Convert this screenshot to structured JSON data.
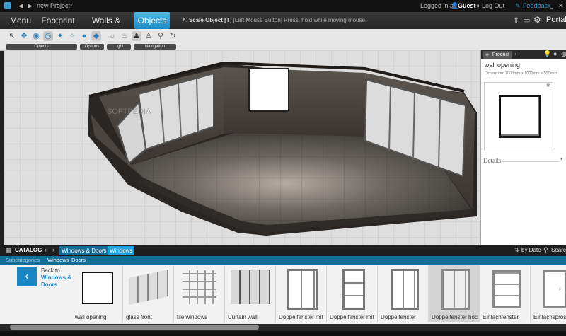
{
  "titlebar": {
    "project": "new Project*"
  },
  "menu": {
    "tabs": [
      {
        "label": "Menu"
      },
      {
        "label": "Footprint"
      },
      {
        "label": "Walls & Floors"
      },
      {
        "label": "Objects"
      }
    ],
    "hint_bold": "Scale Object [T]",
    "hint_text": "[Left Mouse Button] Press, hold while moving mouse.",
    "logged_in": "Logged in as",
    "user": "Guest",
    "logout": "Log Out",
    "feedback": "Feedback",
    "portal": "Portal"
  },
  "toolbar": {
    "groups": [
      "Objects",
      "Options",
      "Light",
      "Navigation"
    ]
  },
  "panel": {
    "tab": "Product",
    "name": "wall opening",
    "dimension": "Dimension: 1000mm x 1000mm x 500mm",
    "details": "Details"
  },
  "catalog": {
    "title": "CATALOG",
    "crumb1": "Windows & Doors",
    "crumb2": "Windows",
    "sort": "by Date",
    "search": "Search",
    "subcat_label": "Subcategories",
    "subcats": [
      "Windows",
      "Doors"
    ],
    "back_line1": "Back to",
    "back_line2": "Windows &",
    "back_line3": "Doors",
    "items": [
      {
        "label": "wall opening"
      },
      {
        "label": "glass front"
      },
      {
        "label": "tile windows"
      },
      {
        "label": "Curtain wall"
      },
      {
        "label": "Doppelfenster mit De"
      },
      {
        "label": "Doppelfenster mit De"
      },
      {
        "label": "Doppelfenster"
      },
      {
        "label": "Doppelfenster hoch"
      },
      {
        "label": "Einfachfenster"
      },
      {
        "label": "Einfachsprossen"
      }
    ]
  },
  "watermark": "SOFTPEDIA"
}
